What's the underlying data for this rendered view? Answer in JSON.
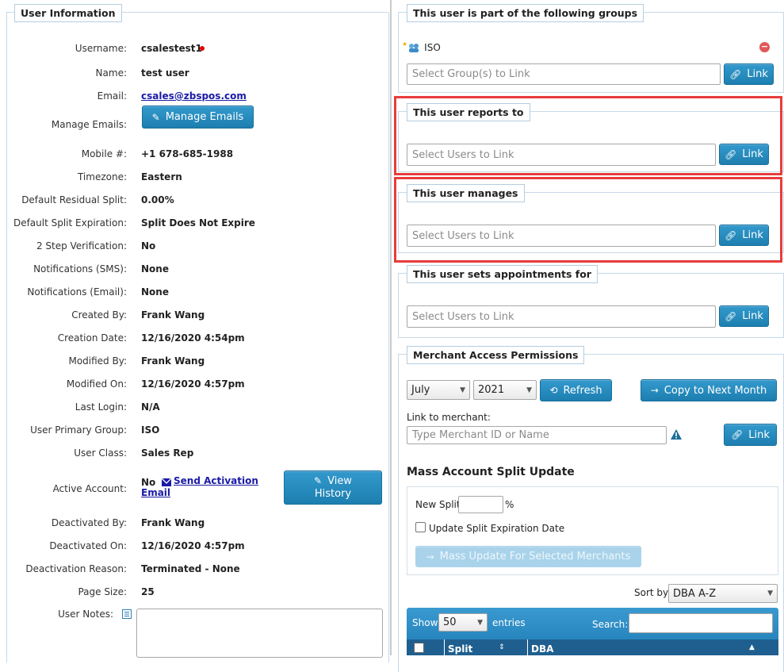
{
  "user_info": {
    "legend": "User Information",
    "rows": [
      {
        "label": "Username:",
        "value": "csalestest1"
      },
      {
        "label": "Name:",
        "value": "test user"
      },
      {
        "label": "Email:",
        "value": "csales@zbspos.com"
      },
      {
        "label": "Manage Emails:",
        "button": "Manage Emails"
      },
      {
        "label": "Mobile #:",
        "value": "+1 678-685-1988"
      },
      {
        "label": "Timezone:",
        "value": "Eastern"
      },
      {
        "label": "Default Residual Split:",
        "value": "0.00%"
      },
      {
        "label": "Default Split Expiration:",
        "value": "Split Does Not Expire"
      },
      {
        "label": "2 Step Verification:",
        "value": "No"
      },
      {
        "label": "Notifications (SMS):",
        "value": "None"
      },
      {
        "label": "Notifications (Email):",
        "value": "None"
      },
      {
        "label": "Created By:",
        "value": "Frank Wang"
      },
      {
        "label": "Creation Date:",
        "value": "12/16/2020 4:54pm"
      },
      {
        "label": "Modified By:",
        "value": "Frank Wang"
      },
      {
        "label": "Modified On:",
        "value": "12/16/2020 4:57pm"
      },
      {
        "label": "Last Login:",
        "value": "N/A"
      },
      {
        "label": "User Primary Group:",
        "value": "ISO"
      },
      {
        "label": "User Class:",
        "value": "Sales Rep"
      },
      {
        "label": "Active Account:",
        "value": "No",
        "link1": "Send Activation",
        "link2": "Email",
        "button": "View",
        "button2": "History"
      },
      {
        "label": "Deactivated By:",
        "value": "Frank Wang"
      },
      {
        "label": "Deactivated On:",
        "value": "12/16/2020 4:57pm"
      },
      {
        "label": "Deactivation Reason:",
        "value": "Terminated - None"
      },
      {
        "label": "Page Size:",
        "value": "25"
      },
      {
        "label": "User Notes:",
        "value": ""
      }
    ]
  },
  "groups": {
    "legend": "This user is part of the following groups",
    "group_name": "ISO",
    "placeholder": "Select Group(s) to Link",
    "link_label": "Link"
  },
  "reports_to": {
    "legend": "This user reports to",
    "placeholder": "Select Users to Link",
    "link_label": "Link"
  },
  "manages": {
    "legend": "This user manages",
    "placeholder": "Select Users to Link",
    "link_label": "Link"
  },
  "appointments": {
    "legend": "This user sets appointments for",
    "placeholder": "Select Users to Link",
    "link_label": "Link"
  },
  "merchant": {
    "legend": "Merchant Access Permissions",
    "month": "July",
    "year": "2021",
    "refresh_label": "Refresh",
    "copy_label": "Copy to Next Month",
    "link_to_label": "Link to merchant:",
    "placeholder": "Type Merchant ID or Name",
    "link_label": "Link",
    "mass_title": "Mass Account Split Update",
    "new_split_label": "New Split",
    "percent": "%",
    "update_exp_label": "Update Split Expiration Date",
    "mass_button": "Mass Update For Selected Merchants",
    "sort_by_label": "Sort by",
    "sort_value": "DBA A-Z",
    "show_label": "Show",
    "entries_value": "50",
    "entries_label": "entries",
    "search_label": "Search:",
    "col_split": "Split",
    "col_dba": "DBA"
  }
}
